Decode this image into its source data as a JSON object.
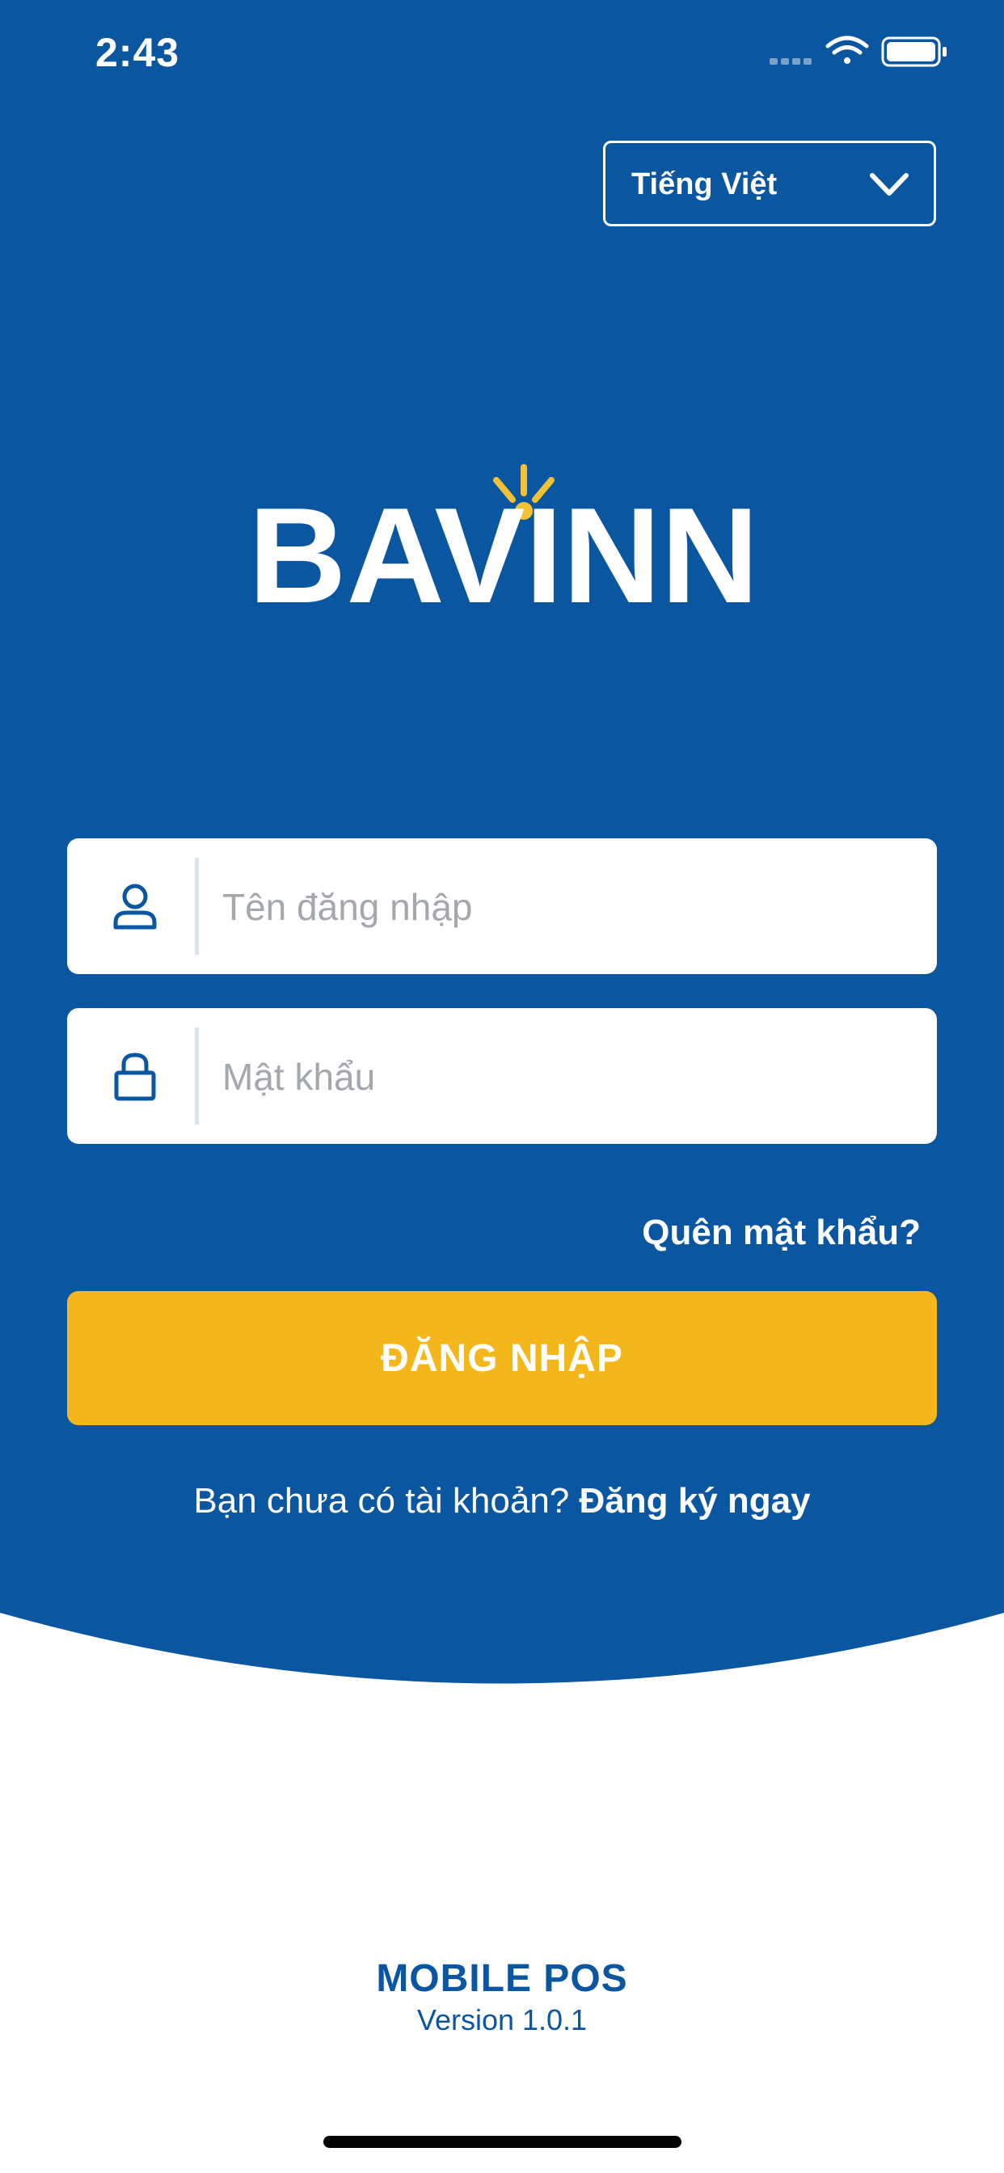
{
  "status_bar": {
    "time": "2:43"
  },
  "language_select": {
    "selected": "Tiếng Việt"
  },
  "logo": {
    "text": "BAVINN"
  },
  "login_form": {
    "username_placeholder": "Tên đăng nhập",
    "password_placeholder": "Mật khẩu",
    "forgot_password": "Quên mật khẩu?",
    "login_button": "ĐĂNG NHẬP",
    "register_prompt": "Bạn chưa có tài khoản?",
    "register_link": "Đăng ký ngay"
  },
  "footer": {
    "app_name": "MOBILE POS",
    "version": "Version 1.0.1"
  },
  "colors": {
    "primary_blue": "#0a56a0",
    "accent_yellow": "#f4b71b",
    "logo_spark": "#f2c134",
    "background": "#ffffff"
  },
  "icons": {
    "username": "user-icon",
    "password": "lock-icon",
    "language_dropdown": "chevron-down-icon",
    "signal": "signal-icon",
    "wifi": "wifi-icon",
    "battery": "battery-icon"
  }
}
